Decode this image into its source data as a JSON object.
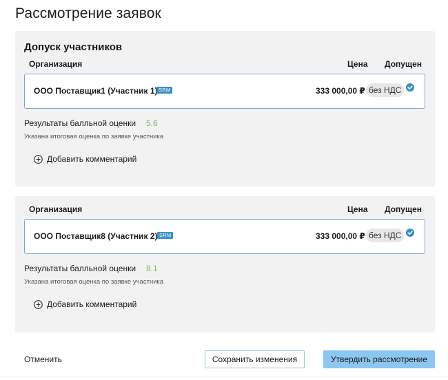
{
  "page": {
    "title": "Рассмотрение заявок"
  },
  "section_heading": "Допуск участников",
  "columns": {
    "organization": "Организация",
    "price": "Цена",
    "admitted": "Допущен"
  },
  "participants": [
    {
      "organization": "ООО Поставщик1 (Участник 1)",
      "badge": "SRM",
      "price": "333 000,00 ₽",
      "vat": "без НДС",
      "admitted": true,
      "score_label": "Результаты балльной оценки",
      "score": "5.6",
      "score_hint": "Указана итоговая оценка по заявке участника",
      "add_comment": "Добавить комментарий"
    },
    {
      "organization": "ООО Поставщик8 (Участник 2)",
      "badge": "SRM",
      "price": "333 000,00 ₽",
      "vat": "без НДС",
      "admitted": true,
      "score_label": "Результаты балльной оценки",
      "score": "8.1",
      "score_hint": "Указана итоговая оценка по заявке участника",
      "add_comment": "Добавить комментарий"
    }
  ],
  "footer": {
    "cancel": "Отменить",
    "save": "Сохранить изменения",
    "approve": "Утвердить рассмотрение"
  },
  "colors": {
    "accent": "#3a8fc8",
    "card_border": "#7aa7cf",
    "score": "#6fbf5a",
    "approve_button": "#8cc7f2",
    "section_bg": "#f2f2f2"
  },
  "icons": {
    "admitted": "check-circle-icon",
    "add_comment": "plus-circle-icon"
  }
}
